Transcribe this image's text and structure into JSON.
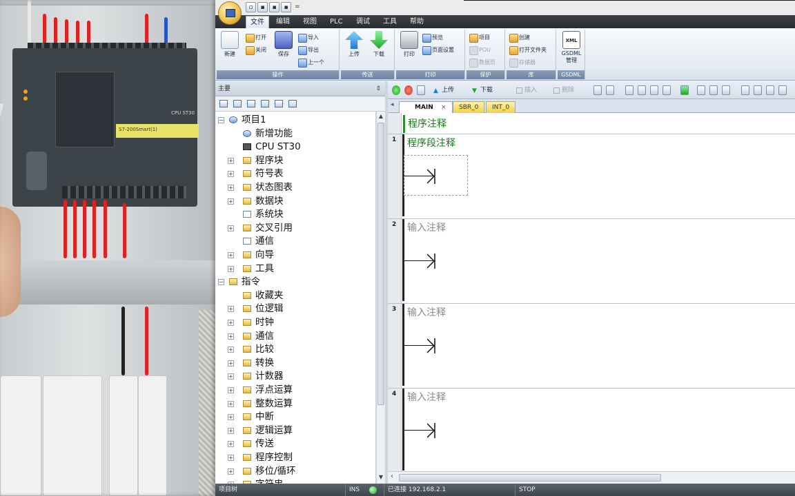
{
  "photo": {
    "lcd_text": "S7-200Smart(1)",
    "cpu_label": "CPU ST30"
  },
  "quick_access": {
    "glyph": "="
  },
  "menu": {
    "items": [
      "文件",
      "编辑",
      "视图",
      "PLC",
      "调试",
      "工具",
      "帮助"
    ],
    "active_index": 0
  },
  "ribbon": {
    "new_label": "新建",
    "open_label": "打开",
    "close_label": "关闭",
    "save_label": "保存",
    "import_label": "导入",
    "export_label": "导出",
    "previous_label": "上一个",
    "group_operate": "操作",
    "upload_label": "上传",
    "download_label": "下载",
    "group_transfer": "传送",
    "print_label": "打印",
    "preview_label": "预览",
    "page_setup_label": "页面设置",
    "group_print": "打印",
    "project_label": "项目",
    "pou_label": "POU",
    "data_page_label": "数据页",
    "group_protect": "保护",
    "create_label": "创建",
    "open_folder_label": "打开文件夹",
    "memory_label": "存储器",
    "group_library": "库",
    "gsdml_icon_text": "XML",
    "gsdml_label": "GSDML",
    "gsdml_manage_label": "管理",
    "group_gsdml": "GSDML"
  },
  "left_pane": {
    "title": "主要",
    "pin": "⇕"
  },
  "tree": {
    "items": [
      {
        "label": "项目1",
        "icon": "gear",
        "expander": "−"
      },
      {
        "label": "新增功能",
        "icon": "gear",
        "expander": ""
      },
      {
        "label": "CPU ST30",
        "icon": "cpu",
        "expander": ""
      },
      {
        "label": "程序块",
        "icon": "folder",
        "expander": "+"
      },
      {
        "label": "符号表",
        "icon": "folder",
        "expander": "+"
      },
      {
        "label": "状态图表",
        "icon": "folder",
        "expander": "+"
      },
      {
        "label": "数据块",
        "icon": "folder",
        "expander": "+"
      },
      {
        "label": "系统块",
        "icon": "doc",
        "expander": ""
      },
      {
        "label": "交叉引用",
        "icon": "folder",
        "expander": "+"
      },
      {
        "label": "通信",
        "icon": "doc",
        "expander": ""
      },
      {
        "label": "向导",
        "icon": "folder",
        "expander": "+"
      },
      {
        "label": "工具",
        "icon": "folder",
        "expander": "+"
      },
      {
        "label": "指令",
        "icon": "folder",
        "expander": "−"
      },
      {
        "label": "收藏夹",
        "icon": "folder",
        "expander": ""
      },
      {
        "label": "位逻辑",
        "icon": "folder",
        "expander": "+"
      },
      {
        "label": "时钟",
        "icon": "folder",
        "expander": "+"
      },
      {
        "label": "通信",
        "icon": "folder",
        "expander": "+"
      },
      {
        "label": "比较",
        "icon": "folder",
        "expander": "+"
      },
      {
        "label": "转换",
        "icon": "folder",
        "expander": "+"
      },
      {
        "label": "计数器",
        "icon": "folder",
        "expander": "+"
      },
      {
        "label": "浮点运算",
        "icon": "folder",
        "expander": "+"
      },
      {
        "label": "整数运算",
        "icon": "folder",
        "expander": "+"
      },
      {
        "label": "中断",
        "icon": "folder",
        "expander": "+"
      },
      {
        "label": "逻辑运算",
        "icon": "folder",
        "expander": "+"
      },
      {
        "label": "传送",
        "icon": "folder",
        "expander": "+"
      },
      {
        "label": "程序控制",
        "icon": "folder",
        "expander": "+"
      },
      {
        "label": "移位/循环",
        "icon": "folder",
        "expander": "+"
      },
      {
        "label": "字符串",
        "icon": "folder",
        "expander": "+"
      }
    ]
  },
  "editor_toolbar": {
    "upload_label": "上传",
    "download_label": "下载",
    "insert_label": "插入",
    "delete_label": "删除"
  },
  "tabs": [
    {
      "label": "MAIN",
      "close": "×"
    },
    {
      "label": "SBR_0"
    },
    {
      "label": "INT_0"
    }
  ],
  "editor": {
    "program_comment": "程序注释",
    "networks": [
      {
        "number": "1",
        "comment": "程序段注释"
      },
      {
        "number": "2",
        "comment": "输入注释"
      },
      {
        "number": "3",
        "comment": "输入注释"
      },
      {
        "number": "4",
        "comment": "输入注释"
      }
    ]
  },
  "status": {
    "tree_label": "项目树",
    "mode": "INS",
    "connection": "已连接 192.168.2.1",
    "plc_state": "STOP"
  },
  "colors": {
    "comment_green": "#1a7a1a",
    "placeholder_gray": "#8a8a8a",
    "menu_dark": "#2b2e31",
    "connected": "#2ea82e"
  }
}
